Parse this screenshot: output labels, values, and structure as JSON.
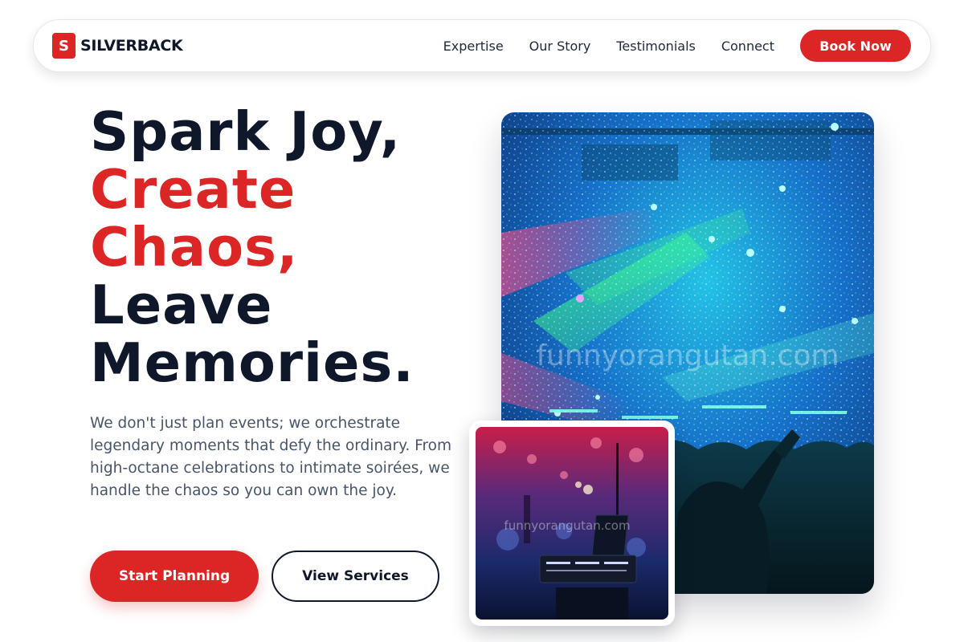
{
  "brand": {
    "logo_letter": "S",
    "name": "SILVERBACK",
    "accent_color": "#dc2626"
  },
  "nav": {
    "links": [
      "Expertise",
      "Our Story",
      "Testimonials",
      "Connect"
    ],
    "cta_label": "Book Now"
  },
  "hero": {
    "headline_line1": "Spark Joy,",
    "headline_line2": "Create",
    "headline_line3": "Chaos,",
    "headline_line4": "Leave",
    "headline_line5": "Memories.",
    "description": "We don't just plan events; we orchestrate legendary moments that defy the ordinary. From high-octane celebrations to intimate soirées, we handle the chaos so you can own the joy.",
    "primary_button": "Start Planning",
    "secondary_button": "View Services"
  },
  "images": {
    "main_watermark": "funnyorangutan.com",
    "small_watermark": "funnyorangutan.com"
  }
}
